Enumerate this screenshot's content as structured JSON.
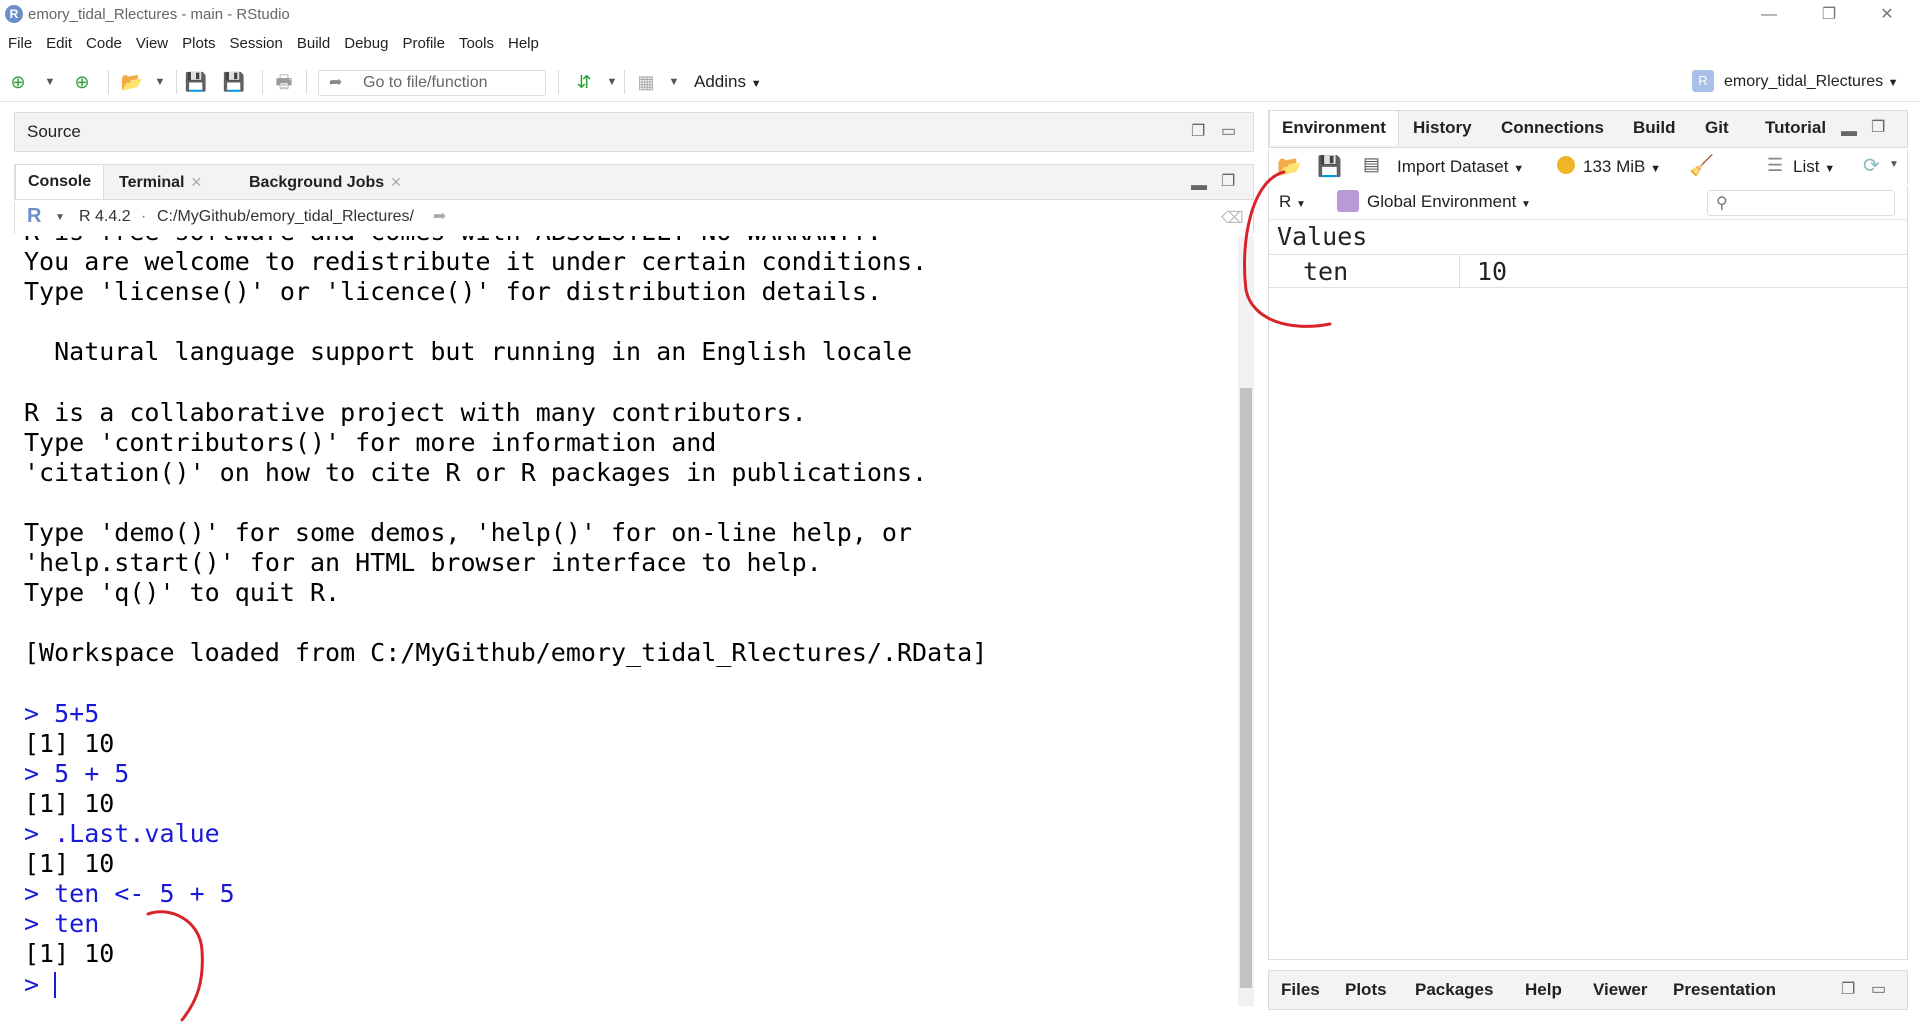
{
  "window": {
    "title": "emory_tidal_Rlectures - main - RStudio",
    "controls": {
      "minimize": "—",
      "restore": "❐",
      "close": "✕"
    }
  },
  "menu": [
    "File",
    "Edit",
    "Code",
    "View",
    "Plots",
    "Session",
    "Build",
    "Debug",
    "Profile",
    "Tools",
    "Help"
  ],
  "toolbar": {
    "goto_placeholder": "Go to file/function",
    "addins_label": "Addins",
    "project_name": "emory_tidal_Rlectures"
  },
  "source_pane": {
    "title": "Source"
  },
  "console_pane": {
    "tabs": [
      {
        "label": "Console"
      },
      {
        "label": "Terminal"
      },
      {
        "label": "Background Jobs"
      }
    ],
    "r_version": "R 4.4.2",
    "path": "C:/MyGithub/emory_tidal_Rlectures/",
    "lines": [
      {
        "text": "R is free software and comes with ABSOLUTELY NO WARRANTY.",
        "type": "out"
      },
      {
        "text": "You are welcome to redistribute it under certain conditions.",
        "type": "out"
      },
      {
        "text": "Type 'license()' or 'licence()' for distribution details.",
        "type": "out"
      },
      {
        "text": "",
        "type": "out"
      },
      {
        "text": "  Natural language support but running in an English locale",
        "type": "out"
      },
      {
        "text": "",
        "type": "out"
      },
      {
        "text": "R is a collaborative project with many contributors.",
        "type": "out"
      },
      {
        "text": "Type 'contributors()' for more information and",
        "type": "out"
      },
      {
        "text": "'citation()' on how to cite R or R packages in publications.",
        "type": "out"
      },
      {
        "text": "",
        "type": "out"
      },
      {
        "text": "Type 'demo()' for some demos, 'help()' for on-line help, or",
        "type": "out"
      },
      {
        "text": "'help.start()' for an HTML browser interface to help.",
        "type": "out"
      },
      {
        "text": "Type 'q()' to quit R.",
        "type": "out"
      },
      {
        "text": "",
        "type": "out"
      },
      {
        "text": "[Workspace loaded from C:/MyGithub/emory_tidal_Rlectures/.RData]",
        "type": "out"
      },
      {
        "text": "",
        "type": "out"
      },
      {
        "text": "> 5+5",
        "type": "cmd"
      },
      {
        "text": "[1] 10",
        "type": "out"
      },
      {
        "text": "> 5 + 5",
        "type": "cmd"
      },
      {
        "text": "[1] 10",
        "type": "out"
      },
      {
        "text": "> .Last.value",
        "type": "cmd"
      },
      {
        "text": "[1] 10",
        "type": "out"
      },
      {
        "text": "> ten <- 5 + 5",
        "type": "cmd"
      },
      {
        "text": "> ten",
        "type": "cmd"
      },
      {
        "text": "[1] 10",
        "type": "out"
      },
      {
        "text": "> ",
        "type": "cmd"
      }
    ]
  },
  "env_pane": {
    "tabs": [
      "Environment",
      "History",
      "Connections",
      "Build",
      "Git",
      "Tutorial"
    ],
    "import_label": "Import Dataset",
    "memory_label": "133 MiB",
    "view_label": "List",
    "language_label": "R",
    "scope_label": "Global Environment",
    "section_header": "Values",
    "values": [
      {
        "name": "ten",
        "value": "10"
      }
    ]
  },
  "files_pane": {
    "tabs": [
      "Files",
      "Plots",
      "Packages",
      "Help",
      "Viewer",
      "Presentation"
    ]
  },
  "colors": {
    "annotation": "#d8232a",
    "command_blue": "#1a1ad6"
  }
}
